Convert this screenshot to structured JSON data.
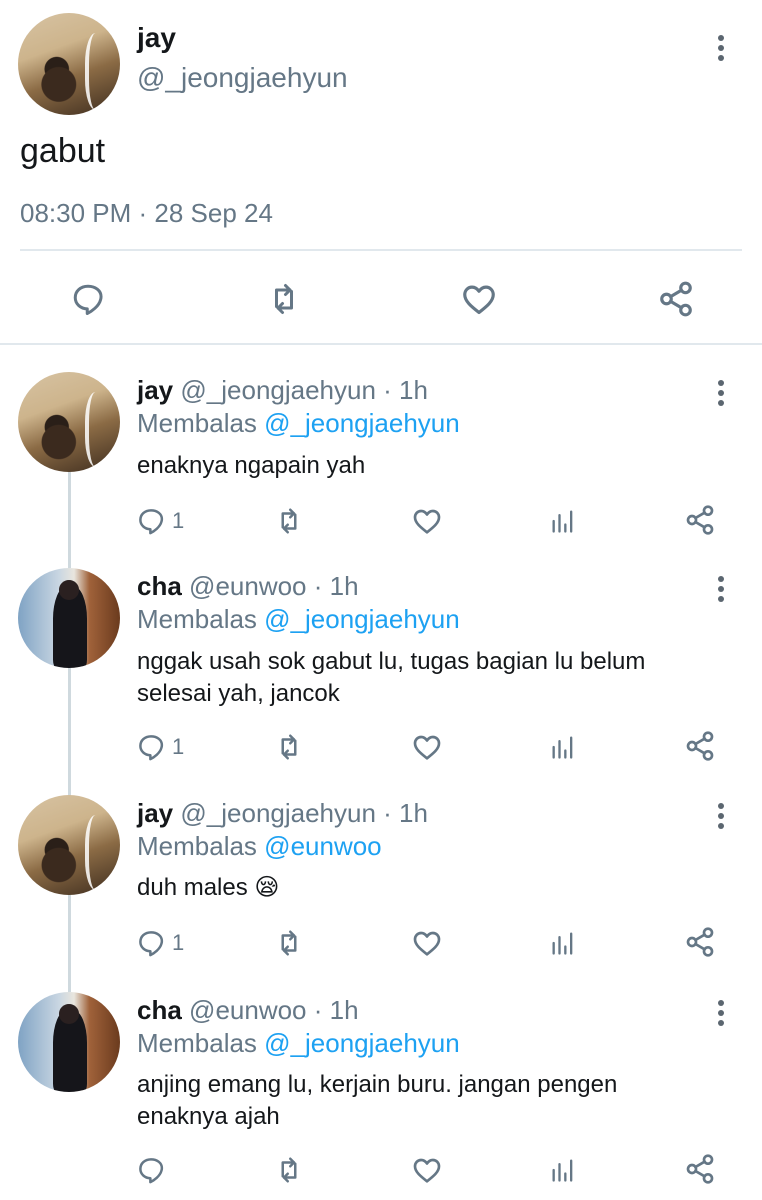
{
  "main_tweet": {
    "display_name": "jay",
    "handle": "@_jeongjaehyun",
    "text": "gabut",
    "timestamp": "08:30 PM · 28 Sep 24",
    "actions": [
      "reply-icon",
      "retweet-icon",
      "like-icon",
      "share-icon"
    ]
  },
  "replies": [
    {
      "display_name": "jay",
      "handle": "@_jeongjaehyun",
      "time": "· 1h",
      "replying_label": "Membalas",
      "replying_to": "@_jeongjaehyun",
      "text": "enaknya ngapain yah",
      "reply_count": "1"
    },
    {
      "display_name": "cha",
      "handle": "@eunwoo",
      "time": "· 1h",
      "replying_label": "Membalas",
      "replying_to": "@_jeongjaehyun",
      "text": "nggak usah sok gabut lu, tugas bagian lu belum selesai yah, jancok",
      "reply_count": "1"
    },
    {
      "display_name": "jay",
      "handle": "@_jeongjaehyun",
      "time": "· 1h",
      "replying_label": "Membalas",
      "replying_to": "@eunwoo",
      "text": "duh males",
      "emoji": "😪",
      "reply_count": "1"
    },
    {
      "display_name": "cha",
      "handle": "@eunwoo",
      "time": "· 1h",
      "replying_label": "Membalas",
      "replying_to": "@_jeongjaehyun",
      "text": "anjing emang lu, kerjain buru. jangan pengen enaknya ajah",
      "reply_count": ""
    }
  ],
  "colors": {
    "text": "#14171a",
    "secondary": "#657786",
    "link": "#1da1f2",
    "divider": "#e1e8ed"
  }
}
